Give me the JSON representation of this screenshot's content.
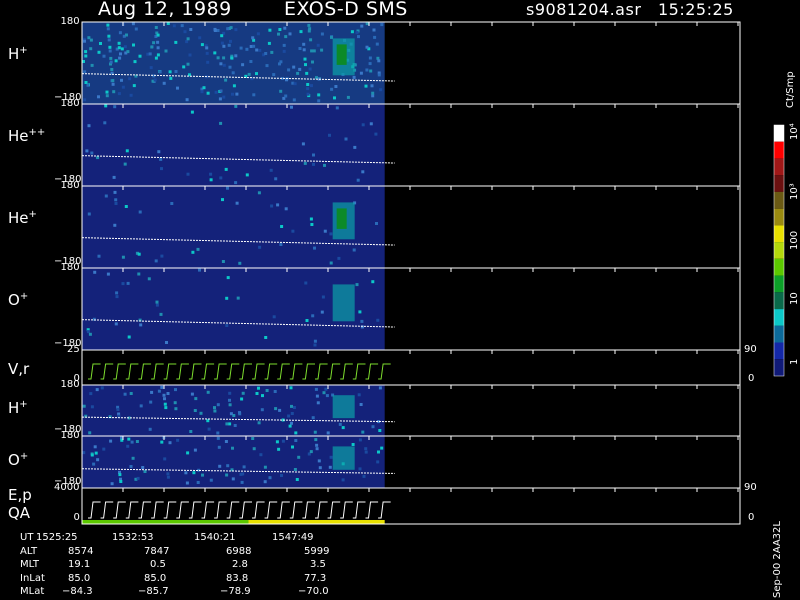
{
  "header": {
    "date": "Aug 12, 1989",
    "instrument": "EXOS-D SMS",
    "file": "s9081204.asr",
    "time": "15:25:25"
  },
  "colorbar": {
    "unit_label": "Ct/Smp",
    "tick_labels": [
      "10⁴",
      "10³",
      "100",
      "10",
      "1"
    ],
    "colors": [
      "#ffffff",
      "#ff0000",
      "#a01818",
      "#6b1010",
      "#6b5a14",
      "#9a8a10",
      "#e8e000",
      "#b4d80c",
      "#5cc800",
      "#0ca028",
      "#0a6a4a",
      "#0cc8c8",
      "#0c6a9a",
      "#1428a8",
      "#101a78"
    ]
  },
  "panels": [
    {
      "id": "h-plus",
      "label": "H",
      "sup": "+",
      "top_tick": "180",
      "bottom_tick": "−180",
      "bg": "#163a82",
      "trace": "#ffffff"
    },
    {
      "id": "he-plus-plus",
      "label": "He",
      "sup": "++",
      "top_tick": "180",
      "bottom_tick": "−180",
      "bg": "#14227a",
      "trace": "#ffffff"
    },
    {
      "id": "he-plus",
      "label": "He",
      "sup": "+",
      "top_tick": "180",
      "bottom_tick": "−180",
      "bg": "#14227a",
      "trace": "#ffffff"
    },
    {
      "id": "o-plus",
      "label": "O",
      "sup": "+",
      "top_tick": "180",
      "bottom_tick": "−180",
      "bg": "#14227a",
      "trace": "#ffffff"
    },
    {
      "id": "v-r",
      "label": "V,r",
      "sup": "",
      "top_tick": "25",
      "bottom_tick": "0",
      "bg": "#000000",
      "trace": "#7ddc2e",
      "right_ticks": [
        "90",
        "0"
      ]
    },
    {
      "id": "h-plus-2",
      "label": "H",
      "sup": "+",
      "top_tick": "180",
      "bottom_tick": "−180",
      "bg": "#14227a",
      "trace": "#ffffff"
    },
    {
      "id": "o-plus-2",
      "label": "O",
      "sup": "+",
      "top_tick": "180",
      "bottom_tick": "−180",
      "bg": "#14227a",
      "trace": "#ffffff"
    },
    {
      "id": "e-p",
      "label": "E,p",
      "label2": "QA",
      "sup": "",
      "top_tick": "4000",
      "bottom_tick": "0",
      "bg": "#000000",
      "trace": "#ffffff",
      "right_ticks": [
        "90",
        "0"
      ]
    }
  ],
  "ephemeris": {
    "row_labels": [
      "UT",
      "ALT",
      "MLT",
      "InLat",
      "MLat"
    ],
    "columns": [
      [
        "1525:25",
        "8574",
        "19.1",
        "85.0",
        "−84.3"
      ],
      [
        "1532:53",
        "7847",
        "0.5",
        "85.0",
        "−85.7"
      ],
      [
        "1540:21",
        "6988",
        "2.8",
        "83.8",
        "−78.9"
      ],
      [
        "1547:49",
        "5999",
        "3.5",
        "77.3",
        "−70.0"
      ]
    ]
  },
  "footer_code": "Sep-00 2AA32L",
  "chart_data": {
    "type": "heatmap",
    "title": "Aug 12, 1989   EXOS-D SMS",
    "x_tick_labels": [
      "1525:25",
      "1532:53",
      "1540:21",
      "1547:49"
    ],
    "data_end_fraction": 0.46,
    "series": [
      {
        "name": "H+",
        "ylim": [
          -180,
          180
        ]
      },
      {
        "name": "He++",
        "ylim": [
          -180,
          180
        ]
      },
      {
        "name": "He+",
        "ylim": [
          -180,
          180
        ]
      },
      {
        "name": "O+",
        "ylim": [
          -180,
          180
        ]
      },
      {
        "name": "V,r",
        "ylim": [
          0,
          25
        ]
      },
      {
        "name": "H+",
        "ylim": [
          -180,
          180
        ]
      },
      {
        "name": "O+",
        "ylim": [
          -180,
          180
        ]
      },
      {
        "name": "E,p",
        "ylim": [
          0,
          4000
        ]
      }
    ]
  }
}
